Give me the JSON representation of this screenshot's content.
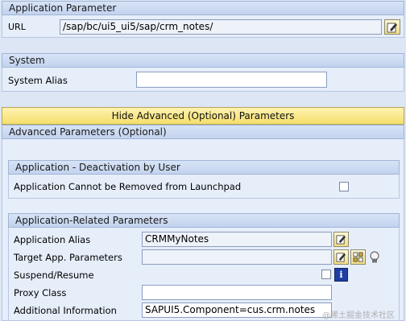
{
  "app_param": {
    "header": "Application Parameter",
    "url_label": "URL",
    "url_value": "/sap/bc/ui5_ui5/sap/crm_notes/"
  },
  "system": {
    "header": "System",
    "alias_label": "System Alias",
    "alias_value": ""
  },
  "toggle_button": "Hide Advanced (Optional) Parameters",
  "advanced": {
    "header": "Advanced Parameters (Optional)",
    "deactivation": {
      "header": "Application - Deactivation by User",
      "cannot_remove_label": "Application Cannot be Removed from Launchpad",
      "cannot_remove_checked": false
    },
    "related": {
      "header": "Application-Related Parameters",
      "alias_label": "Application Alias",
      "alias_value": "CRMMyNotes",
      "target_label": "Target App. Parameters",
      "target_value": "",
      "suspend_label": "Suspend/Resume",
      "suspend_checked": false,
      "proxy_label": "Proxy Class",
      "proxy_value": "",
      "additional_label": "Additional Information",
      "additional_value": "SAPUI5.Component=cus.crm.notes"
    }
  },
  "watermark": "@稀土掘金技术社区",
  "icons": {
    "edit": "edit-pencil-icon",
    "grid": "parameter-grid-icon",
    "bulb": "lightbulb-icon",
    "info": "info-icon"
  }
}
